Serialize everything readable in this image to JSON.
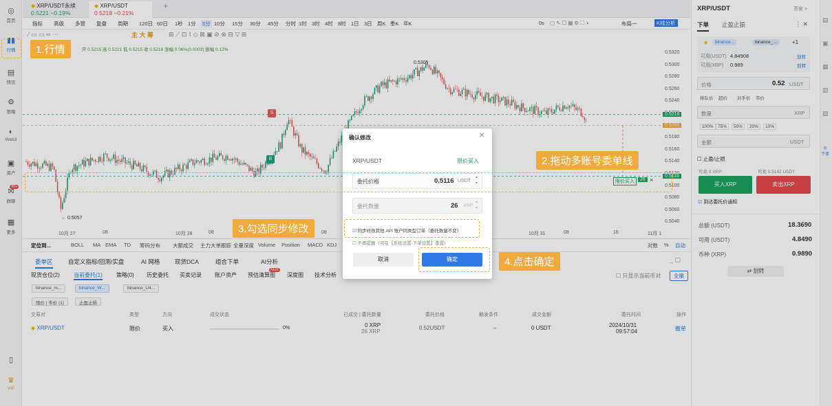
{
  "leftnav": [
    {
      "label": "首页",
      "icon": "◎"
    },
    {
      "label": "行情",
      "icon": "▮▮"
    },
    {
      "label": "快讯",
      "icon": "▤"
    },
    {
      "label": "策略",
      "icon": "⚙"
    },
    {
      "label": "Web3",
      "icon": "◐"
    },
    {
      "label": "资产",
      "icon": "▣"
    },
    {
      "label": "群聊",
      "icon": "✉",
      "badge": "99+"
    },
    {
      "label": "更多",
      "icon": "▦"
    }
  ],
  "leftnav_bottom": {
    "vip": "VIP"
  },
  "page_tabs": [
    {
      "name": "XRP/USDT永续",
      "price": "0.5221",
      "change": "−0.19%"
    },
    {
      "name": "XRP/USDT",
      "price": "0.5218",
      "change": "−0.21%"
    }
  ],
  "toolbar": {
    "items": [
      "指标",
      "高级",
      "多窗",
      "复盘",
      "周期",
      "120日",
      "60日",
      "1秒",
      "1分",
      "5分",
      "10分",
      "15分",
      "30分",
      "45分",
      "分时",
      "1时",
      "3时",
      "4时",
      "8时",
      "1日",
      "3日",
      "周K",
      "季K",
      "年K"
    ],
    "selected": "5分",
    "right": [
      "0s",
      "布局一",
      "K线分析"
    ]
  },
  "ohlc": "开 0.5215  高 0.5221  低 0.5215  收 0.5218  涨幅 0.06%(0.0003)  振幅 0.12%",
  "price_axis": [
    "0.5320",
    "0.5300",
    "0.5280",
    "0.5260",
    "0.5240",
    "0.5220",
    "0.5218",
    "0.5200",
    "0.5180",
    "0.5160",
    "0.5140",
    "0.5120",
    "0.5116",
    "0.5100",
    "0.5080",
    "0.5060",
    "0.5040"
  ],
  "time_axis": [
    "10月 27",
    "08",
    "10月 28",
    "08",
    "16",
    "10月 29",
    "08",
    "16",
    "10月 31",
    "08",
    "16",
    "11月 1"
  ],
  "chart_labels": {
    "high": "0.5305",
    "low": "← 0.5057",
    "sell_mark": "S",
    "buy_mark": "B",
    "order_line": "限价买入",
    "order_qty": "26",
    "order_close": "×"
  },
  "indicators": [
    "定位到...",
    "BOLL",
    "MA",
    "EMA",
    "TD",
    "筹码分布",
    "大额成交",
    "主力大单跟踪",
    "全量深度",
    "Volume",
    "Position",
    "MACD",
    "KDJ"
  ],
  "ind_right": [
    "对数",
    "%",
    "自动"
  ],
  "bottom_tabs": [
    "委单区",
    "自定义指标/回测/实盘",
    "AI 网格",
    "现货DCA",
    "组合下单",
    "AI分析"
  ],
  "sub_tabs": [
    "现货仓位(2)",
    "当前委托(1)",
    "策略(0)",
    "历史委托",
    "买卖记录",
    "账户资产",
    "预估清算图",
    "深度图",
    "技术分析"
  ],
  "sub_tab_badge": "NEW",
  "only_current": "只显示当前币对",
  "full_btn": "全撤",
  "accounts": [
    "binance_m...",
    "binance_W...",
    "binance_U4..."
  ],
  "filter_chips": [
    "限价 | 市价 (1)",
    "止盈止损"
  ],
  "table": {
    "headers": [
      "交易对",
      "类型",
      "方向",
      "成交状态",
      "已成交 | 委托数量",
      "委托价格",
      "触发条件",
      "成交金额",
      "委托时间",
      "操作"
    ],
    "row": {
      "pair": "XRP/USDT",
      "type": "限价",
      "side": "买入",
      "progress": "0%",
      "qty1": "0 XRP",
      "qty2": "26 XRP",
      "price": "0.52USDT",
      "trigger": "--",
      "amount": "0 USDT",
      "time1": "2024/10/31",
      "time2": "09:57:04",
      "action": "撤单"
    }
  },
  "right": {
    "pair": "XRP/USDT",
    "swap": "币安 >",
    "tabs": [
      "下单",
      "止盈止损"
    ],
    "acct1": "binance...",
    "acct2": "binance_...",
    "acct_more": "+1",
    "avail_usdt_label": "可用(USDT)",
    "avail_usdt": "4.84908",
    "avail_xrp_label": "可用(XRP)",
    "avail_xrp": "0.989",
    "transfer": "划转",
    "price_label": "价格",
    "price_value": "0.52",
    "price_unit": "USDT",
    "price_types": [
      "排队价",
      "超价",
      "对手价",
      "市价"
    ],
    "qty_label": "数量",
    "qty_unit": "XRP",
    "pcts": [
      "100%",
      "75%",
      "50%",
      "20%",
      "10%"
    ],
    "amount_label": "金额",
    "amount_unit": "USDT",
    "tpsl": "止盈/止损",
    "can_buy": "可买 9 XRP",
    "can_sell": "可卖 0.5142 USDT",
    "buy_btn": "买入XRP",
    "sell_btn": "卖出XRP",
    "notify": "到达委托价通知",
    "total_label": "总额 (USDT)",
    "total": "18.3690",
    "avail2_label": "可用 (USDT)",
    "avail2": "4.8490",
    "coin_label": "币种 (XRP)",
    "coin": "0.9890",
    "transfer_btn": "⇄ 划转"
  },
  "dialog": {
    "title": "确认修改",
    "pair": "XRP/USDT",
    "side": "限价买入",
    "price_label": "委托价格",
    "price": "0.5116",
    "price_unit": "USDT",
    "qty_label": "委托数量",
    "qty": "26",
    "qty_unit": "XRP",
    "sync_text": "同步修改其他 API 账户同类型订单（委托数量不变）",
    "noremind": "不再提醒（可在【系统设置-下单设置】重置）",
    "cancel": "取消",
    "confirm": "确定"
  },
  "callouts": [
    "1.行情",
    "2.拖动多账号委单线",
    "3.勾选同步修改",
    "4.点击确定"
  ],
  "colors": {
    "accent": "#2f7ae5",
    "up": "#1aa260",
    "down": "#e34a4a",
    "callout": "#f2a93b"
  }
}
